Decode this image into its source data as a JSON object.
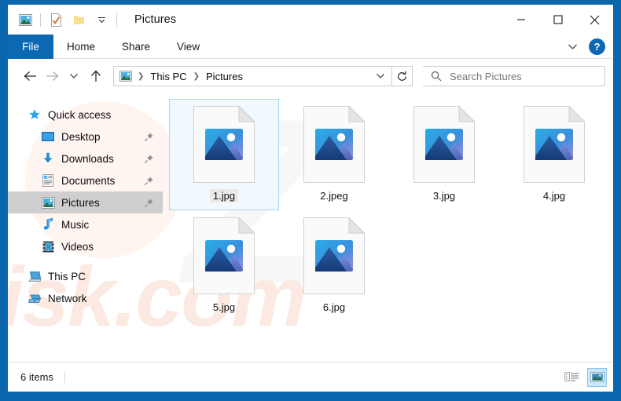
{
  "window": {
    "title": "Pictures",
    "frame_color": "#0b67ad"
  },
  "quick_access_toolbar": {
    "items": [
      {
        "name": "pictures-folder-icon",
        "label": "Pictures"
      },
      {
        "name": "properties-icon",
        "label": "Properties"
      },
      {
        "name": "new-folder-icon",
        "label": "New folder"
      },
      {
        "name": "customize-chevron-icon",
        "label": "Customize Quick Access Toolbar"
      }
    ]
  },
  "window_controls": {
    "minimize": "Minimize",
    "maximize": "Maximize",
    "close": "Close"
  },
  "ribbon": {
    "tabs": [
      {
        "label": "File",
        "active": true
      },
      {
        "label": "Home",
        "active": false
      },
      {
        "label": "Share",
        "active": false
      },
      {
        "label": "View",
        "active": false
      }
    ],
    "expand_label": "Expand the Ribbon",
    "help_label": "?"
  },
  "navbar": {
    "back_label": "Back",
    "forward_label": "Forward",
    "recent_label": "Recent locations",
    "up_label": "Up",
    "refresh_label": "Refresh",
    "breadcrumbs": [
      {
        "label": "This PC"
      },
      {
        "label": "Pictures"
      }
    ]
  },
  "search": {
    "placeholder": "Search Pictures",
    "value": ""
  },
  "sidebar": {
    "items": [
      {
        "label": "Quick access",
        "icon": "star-icon",
        "level": 0,
        "pinned": false,
        "selected": false
      },
      {
        "label": "Desktop",
        "icon": "desktop-icon",
        "level": 1,
        "pinned": true,
        "selected": false
      },
      {
        "label": "Downloads",
        "icon": "downloads-icon",
        "level": 1,
        "pinned": true,
        "selected": false
      },
      {
        "label": "Documents",
        "icon": "documents-icon",
        "level": 1,
        "pinned": true,
        "selected": false
      },
      {
        "label": "Pictures",
        "icon": "pictures-icon",
        "level": 1,
        "pinned": true,
        "selected": true
      },
      {
        "label": "Music",
        "icon": "music-icon",
        "level": 1,
        "pinned": false,
        "selected": false
      },
      {
        "label": "Videos",
        "icon": "videos-icon",
        "level": 1,
        "pinned": false,
        "selected": false
      },
      {
        "label": "This PC",
        "icon": "this-pc-icon",
        "level": 0,
        "pinned": false,
        "selected": false
      },
      {
        "label": "Network",
        "icon": "network-icon",
        "level": 0,
        "pinned": false,
        "selected": false
      }
    ]
  },
  "files": [
    {
      "name": "1.jpg",
      "icon": "picture-file-icon",
      "selected": true
    },
    {
      "name": "2.jpeg",
      "icon": "picture-file-icon",
      "selected": false
    },
    {
      "name": "3.jpg",
      "icon": "picture-file-icon",
      "selected": false
    },
    {
      "name": "4.jpg",
      "icon": "picture-file-icon",
      "selected": false
    },
    {
      "name": "5.jpg",
      "icon": "picture-file-icon",
      "selected": false
    },
    {
      "name": "6.jpg",
      "icon": "picture-file-icon",
      "selected": false
    }
  ],
  "statusbar": {
    "item_count": "6 items",
    "details_view_label": "Details view",
    "large_icons_view_label": "Large icons view"
  },
  "watermark": {
    "text": "risk.com",
    "glyph": "Z"
  },
  "colors": {
    "accent": "#0c68b3",
    "frame": "#0b67ad",
    "selection_fill": "#f2f9fe",
    "selection_border": "#a8d8f0",
    "sidebar_selected": "#cfcfcf"
  }
}
